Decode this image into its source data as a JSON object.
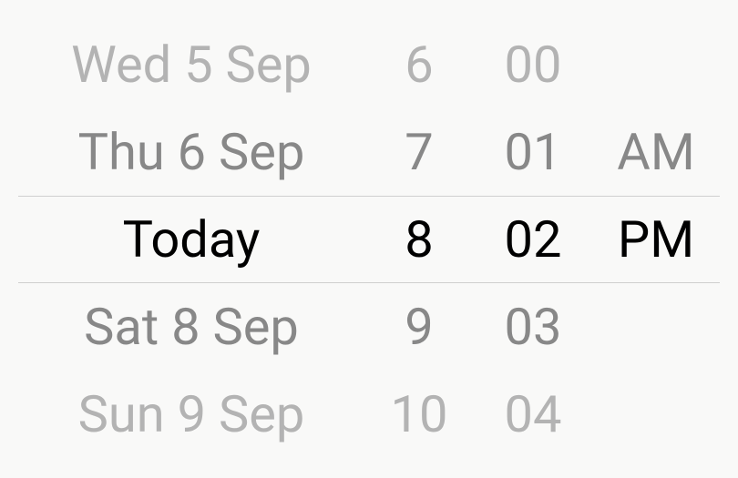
{
  "picker": {
    "rows": [
      {
        "date": "Wed 5 Sep",
        "hour": "6",
        "minute": "00",
        "ampm": ""
      },
      {
        "date": "Thu 6 Sep",
        "hour": "7",
        "minute": "01",
        "ampm": "AM"
      },
      {
        "date": "Today",
        "hour": "8",
        "minute": "02",
        "ampm": "PM"
      },
      {
        "date": "Sat 8 Sep",
        "hour": "9",
        "minute": "03",
        "ampm": ""
      },
      {
        "date": "Sun 9 Sep",
        "hour": "10",
        "minute": "04",
        "ampm": ""
      }
    ],
    "selected_index": 2
  }
}
